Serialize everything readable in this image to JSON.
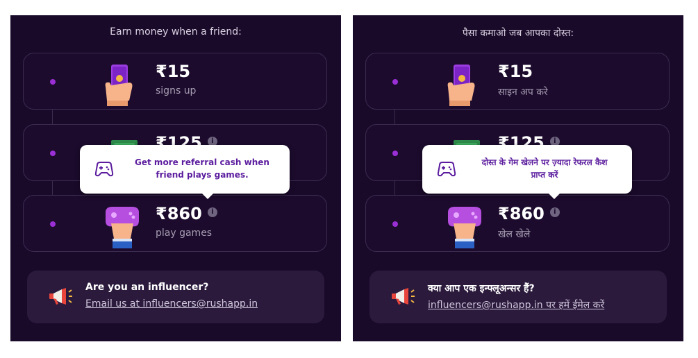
{
  "colors": {
    "panel_bg": "#1a0a2a",
    "accent": "#9b2fd6",
    "tooltip_text": "#5b1d9e",
    "card_border": "#3b2b4f"
  },
  "panels": [
    {
      "title": "Earn money when a friend:",
      "steps": [
        {
          "amount": "₹15",
          "label": "signs up",
          "icon": "phone-in-hand-icon"
        },
        {
          "amount": "₹125",
          "label": "",
          "icon": "cash-notes-icon"
        },
        {
          "amount": "₹860",
          "label": "play games",
          "icon": "game-controller-hand-icon"
        }
      ],
      "tooltip": {
        "line1": "Get more referral cash when",
        "line2": "friend plays games.",
        "icon": "gamepad-icon"
      },
      "influencer": {
        "title": "Are you an influencer?",
        "link": "Email us at influencers@rushapp.in",
        "icon": "megaphone-icon"
      }
    },
    {
      "title": "पैसा कमाओ जब आपका दोस्त:",
      "steps": [
        {
          "amount": "₹15",
          "label": "साइन अप करे",
          "icon": "phone-in-hand-icon"
        },
        {
          "amount": "₹125",
          "label": "",
          "icon": "cash-notes-icon"
        },
        {
          "amount": "₹860",
          "label": "खेल खेले",
          "icon": "game-controller-hand-icon"
        }
      ],
      "tooltip": {
        "line1": "दोस्त के गेम खेलने पर ज़्यादा रेफरल कैश",
        "line2": "प्राप्त करें",
        "icon": "gamepad-icon"
      },
      "influencer": {
        "title": "क्या आप एक इन्फ्लूअन्सर हैं?",
        "link": "influencers@rushapp.in पर हमें ईमेल करें",
        "icon": "megaphone-icon"
      }
    }
  ],
  "info_glyph": "i"
}
